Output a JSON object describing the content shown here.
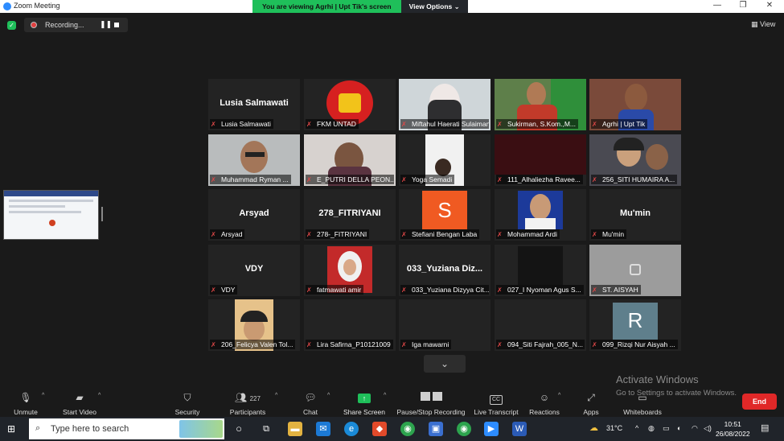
{
  "window": {
    "title": "Zoom Meeting",
    "controls": {
      "minimize": "—",
      "restore": "❐",
      "close": "✕"
    }
  },
  "banner": {
    "message": "You are viewing Agrhi | Upt Tik's screen",
    "options_label": "View Options ⌄"
  },
  "recording": {
    "label": "Recording..."
  },
  "view_button": {
    "label": "View"
  },
  "participants": [
    {
      "label": "Lusia Salmawati",
      "bigname": "Lusia Salmawati"
    },
    {
      "label": "FKM UNTAD",
      "bigname": ""
    },
    {
      "label": "Miftahul Haerati Sulaiman",
      "bigname": ""
    },
    {
      "label": "Sukirman, S.Kom.,M...",
      "bigname": ""
    },
    {
      "label": "Agrhi | Upt Tik",
      "bigname": ""
    },
    {
      "label": "Muhammad Ryman ...",
      "bigname": ""
    },
    {
      "label": "E_PUTRI DELLA PEON...",
      "bigname": ""
    },
    {
      "label": "Yoga Semadi",
      "bigname": ""
    },
    {
      "label": "111_Alhaliezha Ravee...",
      "bigname": ""
    },
    {
      "label": "256_SITI HUMAIRA A...",
      "bigname": ""
    },
    {
      "label": "Arsyad",
      "bigname": "Arsyad"
    },
    {
      "label": "278-_FITRIYANI",
      "bigname": "278_FITRIYANI"
    },
    {
      "label": "Stefiani Bengan Laba",
      "bigname": "S"
    },
    {
      "label": "Mohammad Ardi",
      "bigname": ""
    },
    {
      "label": "Mu'min",
      "bigname": "Mu'min"
    },
    {
      "label": "VDY",
      "bigname": "VDY"
    },
    {
      "label": "fatmawati amir",
      "bigname": ""
    },
    {
      "label": "033_Yuziana Dizyya Cit...",
      "bigname": "033_Yuziana Diz..."
    },
    {
      "label": "027_I Nyoman Agus S...",
      "bigname": ""
    },
    {
      "label": "ST. AISYAH",
      "bigname": ""
    },
    {
      "label": "206_Felicya Valen Tol...",
      "bigname": ""
    },
    {
      "label": "Lira Safirna_P10121009",
      "bigname": ""
    },
    {
      "label": "Iga mawarni",
      "bigname": ""
    },
    {
      "label": "094_Siti Fajrah_005_N...",
      "bigname": ""
    },
    {
      "label": "099_Rizqi Nur Aisyah ...",
      "bigname": "R"
    }
  ],
  "activation": {
    "title": "Activate Windows",
    "subtitle": "Go to Settings to activate Windows."
  },
  "toolbar": {
    "unmute": "Unmute",
    "start_video": "Start Video",
    "security": "Security",
    "participants": "Participants",
    "participants_count": "227",
    "chat": "Chat",
    "share_screen": "Share Screen",
    "pause_stop_recording": "Pause/Stop Recording",
    "live_transcript": "Live Transcript",
    "live_transcript_icon": "CC",
    "reactions": "Reactions",
    "apps": "Apps",
    "whiteboards": "Whiteboards",
    "end": "End"
  },
  "taskbar": {
    "search_placeholder": "Type here to search",
    "temperature": "31°C",
    "time": "10:51",
    "date": "26/08/2022"
  },
  "colors": {
    "share_green": "#1fbf5a",
    "end_red": "#e02828",
    "active_speaker": "#d6e04a",
    "muted_red": "#e24848"
  }
}
